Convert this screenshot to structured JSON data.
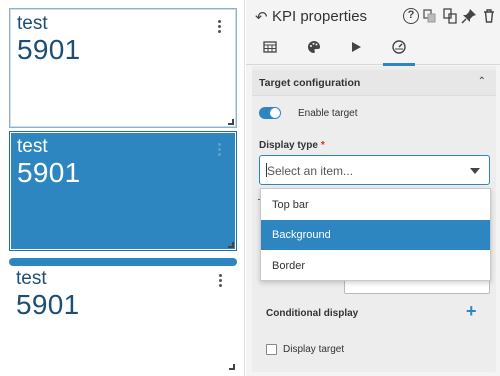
{
  "kpis": [
    {
      "title": "test",
      "value": "5901"
    },
    {
      "title": "test",
      "value": "5901"
    },
    {
      "title": "test",
      "value": "5901"
    }
  ],
  "panel": {
    "back_icon": "back-arrow-icon",
    "title": "KPI properties",
    "header_icons": [
      "help-icon",
      "duplicate-icon",
      "copy-icon",
      "pin-icon",
      "trash-icon"
    ],
    "tabs": [
      {
        "icon": "table-icon"
      },
      {
        "icon": "palette-icon"
      },
      {
        "icon": "play-icon"
      },
      {
        "icon": "gauge-icon",
        "active": true
      }
    ],
    "section": {
      "title": "Target configuration",
      "collapse_icon": "chevron-up-icon"
    },
    "enable_target": {
      "label": "Enable target",
      "on": true
    },
    "display_type": {
      "label": "Display type",
      "required_mark": "*",
      "placeholder": "Select an item...",
      "options": [
        "Top bar",
        "Background",
        "Border"
      ],
      "highlighted": "Background"
    },
    "conditional_display": {
      "label": "Conditional display",
      "add_icon": "plus-icon"
    },
    "display_target": {
      "label": "Display target",
      "checked": false
    }
  },
  "colors": {
    "accent": "#2e86c1",
    "kpi_text": "#1c4f77",
    "required": "#d32f2f"
  }
}
